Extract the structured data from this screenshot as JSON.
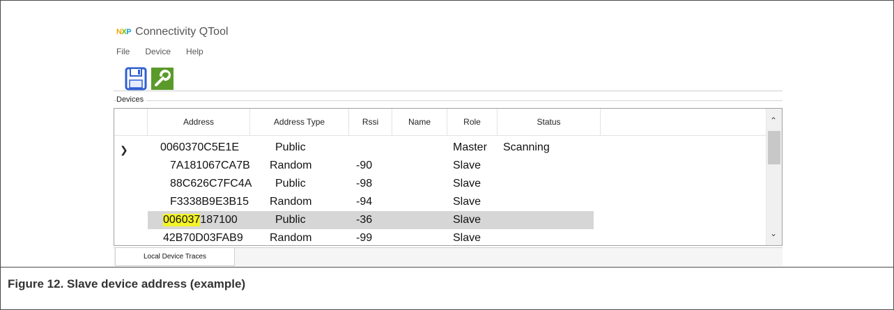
{
  "app": {
    "logo_n": "N",
    "logo_x": "X",
    "logo_p": "P",
    "title": "Connectivity QTool"
  },
  "menu": [
    "File",
    "Device",
    "Help"
  ],
  "toolbar": {
    "save_icon": "floppy-disk-icon",
    "settings_icon": "wrench-icon"
  },
  "devices_group": {
    "label": "Devices"
  },
  "table": {
    "headers": [
      "Address",
      "Address Type",
      "Rssi",
      "Name",
      "Role",
      "Status"
    ],
    "rows": [
      {
        "address": "0060370C5E1E",
        "type": "Public",
        "rssi": "",
        "name": "",
        "role": "Master",
        "status": "Scanning",
        "expanded": true
      },
      {
        "address": "7A181067CA7B",
        "type": "Random",
        "rssi": "-90",
        "name": "",
        "role": "Slave",
        "status": ""
      },
      {
        "address": "88C626C7FC4A",
        "type": "Public",
        "rssi": "-98",
        "name": "",
        "role": "Slave",
        "status": ""
      },
      {
        "address": "F3338B9E3B15",
        "type": "Random",
        "rssi": "-94",
        "name": "",
        "role": "Slave",
        "status": ""
      },
      {
        "address_highlight": "006037",
        "address_rest": "187100",
        "type": "Public",
        "rssi": "-36",
        "name": "",
        "role": "Slave",
        "status": "",
        "selected": true
      },
      {
        "address": "42B70D03FAB9",
        "type": "Random",
        "rssi": "-99",
        "name": "",
        "role": "Slave",
        "status": ""
      }
    ]
  },
  "tabs": [
    "Local Device Traces"
  ],
  "caption": "Figure 12. Slave device address (example)",
  "colors": {
    "highlight": "#f3f32a",
    "selected_row": "#d6d6d6",
    "save_icon": "#2f5fd0",
    "settings_icon": "#5a9a2a"
  }
}
